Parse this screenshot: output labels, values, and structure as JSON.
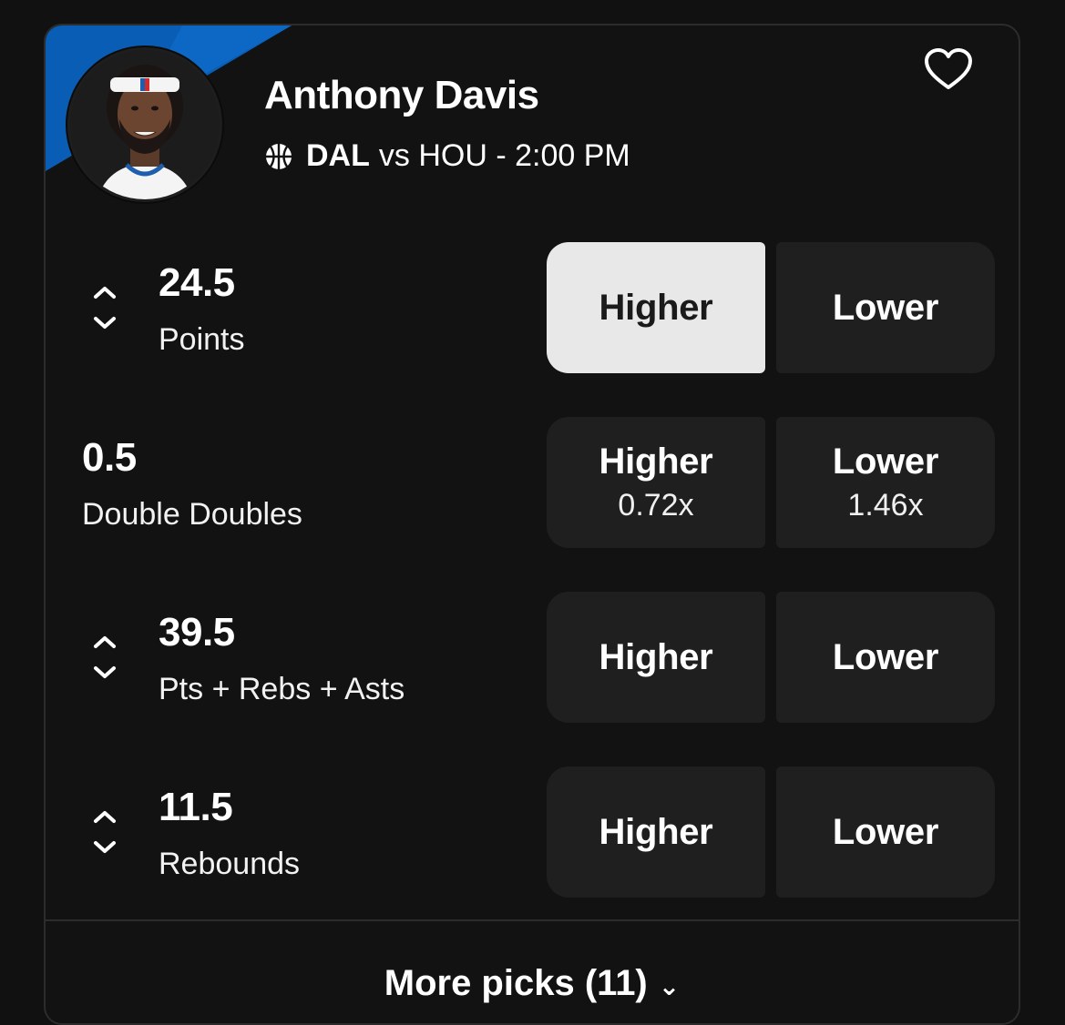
{
  "player": {
    "name": "Anthony Davis",
    "team": "DAL",
    "matchup_rest": "vs HOU - 2:00 PM"
  },
  "colors": {
    "accent_stripe": "#0a5db4",
    "button_bg": "#1f1f1f",
    "button_selected_bg": "#e8e8e8"
  },
  "icons": {
    "sport": "basketball-icon",
    "favorite": "heart-outline-icon",
    "adjust": "up-down-chevron-icon"
  },
  "props": [
    {
      "line": "24.5",
      "stat": "Points",
      "adjustable": true,
      "higher_label": "Higher",
      "lower_label": "Lower",
      "higher_multiplier": "",
      "lower_multiplier": "",
      "selected": "higher"
    },
    {
      "line": "0.5",
      "stat": "Double Doubles",
      "adjustable": false,
      "higher_label": "Higher",
      "lower_label": "Lower",
      "higher_multiplier": "0.72x",
      "lower_multiplier": "1.46x",
      "selected": ""
    },
    {
      "line": "39.5",
      "stat": "Pts + Rebs + Asts",
      "adjustable": true,
      "higher_label": "Higher",
      "lower_label": "Lower",
      "higher_multiplier": "",
      "lower_multiplier": "",
      "selected": ""
    },
    {
      "line": "11.5",
      "stat": "Rebounds",
      "adjustable": true,
      "higher_label": "Higher",
      "lower_label": "Lower",
      "higher_multiplier": "",
      "lower_multiplier": "",
      "selected": ""
    }
  ],
  "more_picks": {
    "label": "More picks (11)"
  }
}
